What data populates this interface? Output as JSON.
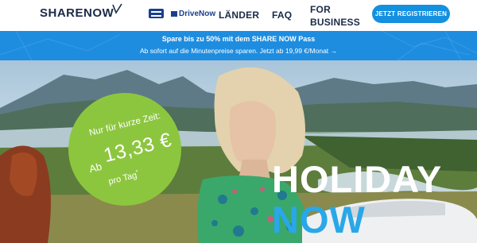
{
  "header": {
    "logo_text": "SHARENOW",
    "brand_icons": [
      "car2go-logo-icon",
      "drivenow-logo-icon"
    ],
    "drivenow_label": "DriveNow",
    "nav": {
      "laender": "LÄNDER",
      "faq": "FAQ",
      "business": "FOR BUSINESS"
    },
    "register_button": "JETZT REGISTRIEREN"
  },
  "banner": {
    "line1": "Spare bis zu 50% mit dem SHARE NOW Pass",
    "line2": "Ab sofort auf die Minutenpreise sparen. Jetzt ab 19,99 €/Monat →"
  },
  "hero": {
    "badge": {
      "line1": "Nur für kurze Zeit:",
      "prefix": "Ab",
      "price": "13,33 €",
      "suffix": "pro Tag",
      "footnote_mark": "*"
    },
    "headline_1": "HOLIDAY",
    "headline_2": "NOW"
  },
  "colors": {
    "brand_navy": "#1b2a47",
    "accent_blue": "#1490e0",
    "banner_blue": "#1e8de0",
    "badge_green": "#8cc63f",
    "headline_blue": "#2aa7e8"
  }
}
